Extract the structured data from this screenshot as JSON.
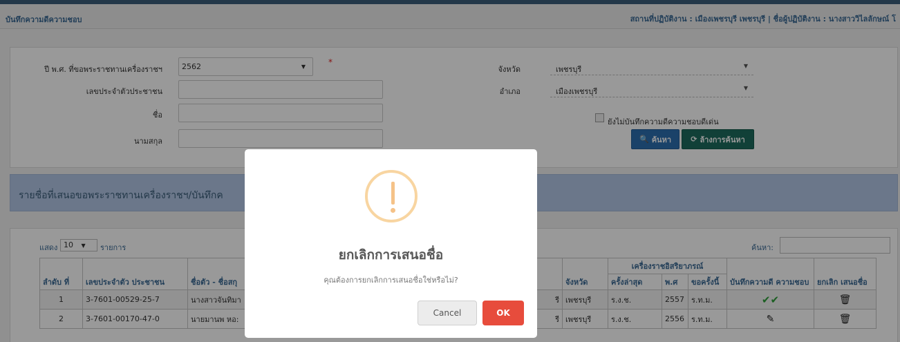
{
  "header": {
    "title": "บันทึกความดีความชอบ",
    "user_info": "สถานที่ปฏิบัติงาน : เมืองเพชรบุรี เพชรบุรี | ชื่อผู้ปฏิบัติงาน : นางสาววิไลลักษณ์ โ"
  },
  "search": {
    "year_label": "ปี พ.ศ. ที่ขอพระราชทานเครื่องราชฯ",
    "year_value": "2562",
    "required_mark": "*",
    "id_label": "เลขประจำตัวประชาชน",
    "name_label": "ชื่อ",
    "surname_label": "นามสกุล",
    "province_label": "จังหวัด",
    "province_value": "เพชรบุรี",
    "district_label": "อำเภอ",
    "district_value": "เมืองเพชรบุรี",
    "checkbox_label": "ยังไม่บันทึกความดีความชอบดีเด่น",
    "search_button": "ค้นหา",
    "clear_button": "ล้างการค้นหา"
  },
  "list": {
    "title": "รายชื่อที่เสนอขอพระราชทานเครื่องราชฯ/บันทึกค",
    "show_label": "แสดง",
    "page_size": "10",
    "items_label": "รายการ",
    "search_label": "ค้นหา:"
  },
  "table": {
    "headers": {
      "no": "ลำดับ ที่",
      "id": "เลขประจำตัว ประชาชน",
      "name": "ชื่อตัว - ชื่อสกุ",
      "province": "จังหวัด",
      "decoration_group": "เครื่องราชอิสริยาภรณ์",
      "latest": "ครั้งล่าสุด",
      "year": "พ.ศ",
      "request": "ขอครั้งนี้",
      "merit": "บันทึกความดี ความชอบ",
      "cancel": "ยกเลิก เสนอชื่อ"
    },
    "rows": [
      {
        "no": "1",
        "id": "3-7601-00529-25-7",
        "name": "นางสาวจันทิมา",
        "pre_province": "รี",
        "province": "เพชรบุรี",
        "latest": "ร.ง.ช.",
        "year": "2557",
        "request": "ร.ท.ม.",
        "merit_icon": "double-check-icon"
      },
      {
        "no": "2",
        "id": "3-7601-00170-47-0",
        "name": "นายมานพ หอ:",
        "pre_province": "รี",
        "province": "เพชรบุรี",
        "latest": "ร.ง.ช.",
        "year": "2556",
        "request": "ร.ท.ม.",
        "merit_icon": "pencil-icon"
      }
    ]
  },
  "dialog": {
    "title": "ยกเลิกการเสนอชื่อ",
    "message": "คุณต้องการยกเลิกการเสนอชื่อใช่หรือไม่?",
    "cancel_label": "Cancel",
    "ok_label": "OK",
    "icon": "warning-icon",
    "ok_color": "#e74c3c"
  }
}
